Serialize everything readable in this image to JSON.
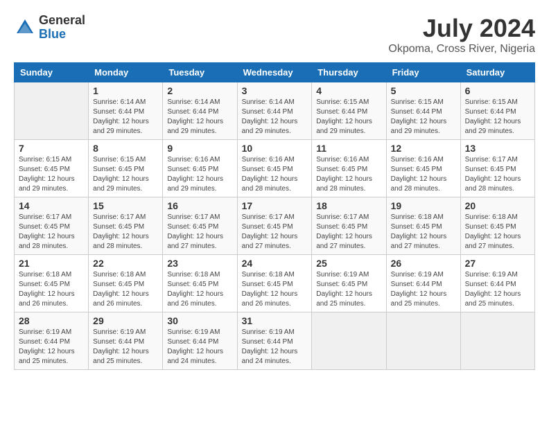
{
  "header": {
    "logo_general": "General",
    "logo_blue": "Blue",
    "month_title": "July 2024",
    "location": "Okpoma, Cross River, Nigeria"
  },
  "days_of_week": [
    "Sunday",
    "Monday",
    "Tuesday",
    "Wednesday",
    "Thursday",
    "Friday",
    "Saturday"
  ],
  "weeks": [
    [
      {
        "num": "",
        "sunrise": "",
        "sunset": "",
        "daylight": ""
      },
      {
        "num": "1",
        "sunrise": "Sunrise: 6:14 AM",
        "sunset": "Sunset: 6:44 PM",
        "daylight": "Daylight: 12 hours and 29 minutes."
      },
      {
        "num": "2",
        "sunrise": "Sunrise: 6:14 AM",
        "sunset": "Sunset: 6:44 PM",
        "daylight": "Daylight: 12 hours and 29 minutes."
      },
      {
        "num": "3",
        "sunrise": "Sunrise: 6:14 AM",
        "sunset": "Sunset: 6:44 PM",
        "daylight": "Daylight: 12 hours and 29 minutes."
      },
      {
        "num": "4",
        "sunrise": "Sunrise: 6:15 AM",
        "sunset": "Sunset: 6:44 PM",
        "daylight": "Daylight: 12 hours and 29 minutes."
      },
      {
        "num": "5",
        "sunrise": "Sunrise: 6:15 AM",
        "sunset": "Sunset: 6:44 PM",
        "daylight": "Daylight: 12 hours and 29 minutes."
      },
      {
        "num": "6",
        "sunrise": "Sunrise: 6:15 AM",
        "sunset": "Sunset: 6:44 PM",
        "daylight": "Daylight: 12 hours and 29 minutes."
      }
    ],
    [
      {
        "num": "7",
        "sunrise": "Sunrise: 6:15 AM",
        "sunset": "Sunset: 6:45 PM",
        "daylight": "Daylight: 12 hours and 29 minutes."
      },
      {
        "num": "8",
        "sunrise": "Sunrise: 6:15 AM",
        "sunset": "Sunset: 6:45 PM",
        "daylight": "Daylight: 12 hours and 29 minutes."
      },
      {
        "num": "9",
        "sunrise": "Sunrise: 6:16 AM",
        "sunset": "Sunset: 6:45 PM",
        "daylight": "Daylight: 12 hours and 29 minutes."
      },
      {
        "num": "10",
        "sunrise": "Sunrise: 6:16 AM",
        "sunset": "Sunset: 6:45 PM",
        "daylight": "Daylight: 12 hours and 28 minutes."
      },
      {
        "num": "11",
        "sunrise": "Sunrise: 6:16 AM",
        "sunset": "Sunset: 6:45 PM",
        "daylight": "Daylight: 12 hours and 28 minutes."
      },
      {
        "num": "12",
        "sunrise": "Sunrise: 6:16 AM",
        "sunset": "Sunset: 6:45 PM",
        "daylight": "Daylight: 12 hours and 28 minutes."
      },
      {
        "num": "13",
        "sunrise": "Sunrise: 6:17 AM",
        "sunset": "Sunset: 6:45 PM",
        "daylight": "Daylight: 12 hours and 28 minutes."
      }
    ],
    [
      {
        "num": "14",
        "sunrise": "Sunrise: 6:17 AM",
        "sunset": "Sunset: 6:45 PM",
        "daylight": "Daylight: 12 hours and 28 minutes."
      },
      {
        "num": "15",
        "sunrise": "Sunrise: 6:17 AM",
        "sunset": "Sunset: 6:45 PM",
        "daylight": "Daylight: 12 hours and 28 minutes."
      },
      {
        "num": "16",
        "sunrise": "Sunrise: 6:17 AM",
        "sunset": "Sunset: 6:45 PM",
        "daylight": "Daylight: 12 hours and 27 minutes."
      },
      {
        "num": "17",
        "sunrise": "Sunrise: 6:17 AM",
        "sunset": "Sunset: 6:45 PM",
        "daylight": "Daylight: 12 hours and 27 minutes."
      },
      {
        "num": "18",
        "sunrise": "Sunrise: 6:17 AM",
        "sunset": "Sunset: 6:45 PM",
        "daylight": "Daylight: 12 hours and 27 minutes."
      },
      {
        "num": "19",
        "sunrise": "Sunrise: 6:18 AM",
        "sunset": "Sunset: 6:45 PM",
        "daylight": "Daylight: 12 hours and 27 minutes."
      },
      {
        "num": "20",
        "sunrise": "Sunrise: 6:18 AM",
        "sunset": "Sunset: 6:45 PM",
        "daylight": "Daylight: 12 hours and 27 minutes."
      }
    ],
    [
      {
        "num": "21",
        "sunrise": "Sunrise: 6:18 AM",
        "sunset": "Sunset: 6:45 PM",
        "daylight": "Daylight: 12 hours and 26 minutes."
      },
      {
        "num": "22",
        "sunrise": "Sunrise: 6:18 AM",
        "sunset": "Sunset: 6:45 PM",
        "daylight": "Daylight: 12 hours and 26 minutes."
      },
      {
        "num": "23",
        "sunrise": "Sunrise: 6:18 AM",
        "sunset": "Sunset: 6:45 PM",
        "daylight": "Daylight: 12 hours and 26 minutes."
      },
      {
        "num": "24",
        "sunrise": "Sunrise: 6:18 AM",
        "sunset": "Sunset: 6:45 PM",
        "daylight": "Daylight: 12 hours and 26 minutes."
      },
      {
        "num": "25",
        "sunrise": "Sunrise: 6:19 AM",
        "sunset": "Sunset: 6:45 PM",
        "daylight": "Daylight: 12 hours and 25 minutes."
      },
      {
        "num": "26",
        "sunrise": "Sunrise: 6:19 AM",
        "sunset": "Sunset: 6:44 PM",
        "daylight": "Daylight: 12 hours and 25 minutes."
      },
      {
        "num": "27",
        "sunrise": "Sunrise: 6:19 AM",
        "sunset": "Sunset: 6:44 PM",
        "daylight": "Daylight: 12 hours and 25 minutes."
      }
    ],
    [
      {
        "num": "28",
        "sunrise": "Sunrise: 6:19 AM",
        "sunset": "Sunset: 6:44 PM",
        "daylight": "Daylight: 12 hours and 25 minutes."
      },
      {
        "num": "29",
        "sunrise": "Sunrise: 6:19 AM",
        "sunset": "Sunset: 6:44 PM",
        "daylight": "Daylight: 12 hours and 25 minutes."
      },
      {
        "num": "30",
        "sunrise": "Sunrise: 6:19 AM",
        "sunset": "Sunset: 6:44 PM",
        "daylight": "Daylight: 12 hours and 24 minutes."
      },
      {
        "num": "31",
        "sunrise": "Sunrise: 6:19 AM",
        "sunset": "Sunset: 6:44 PM",
        "daylight": "Daylight: 12 hours and 24 minutes."
      },
      {
        "num": "",
        "sunrise": "",
        "sunset": "",
        "daylight": ""
      },
      {
        "num": "",
        "sunrise": "",
        "sunset": "",
        "daylight": ""
      },
      {
        "num": "",
        "sunrise": "",
        "sunset": "",
        "daylight": ""
      }
    ]
  ]
}
